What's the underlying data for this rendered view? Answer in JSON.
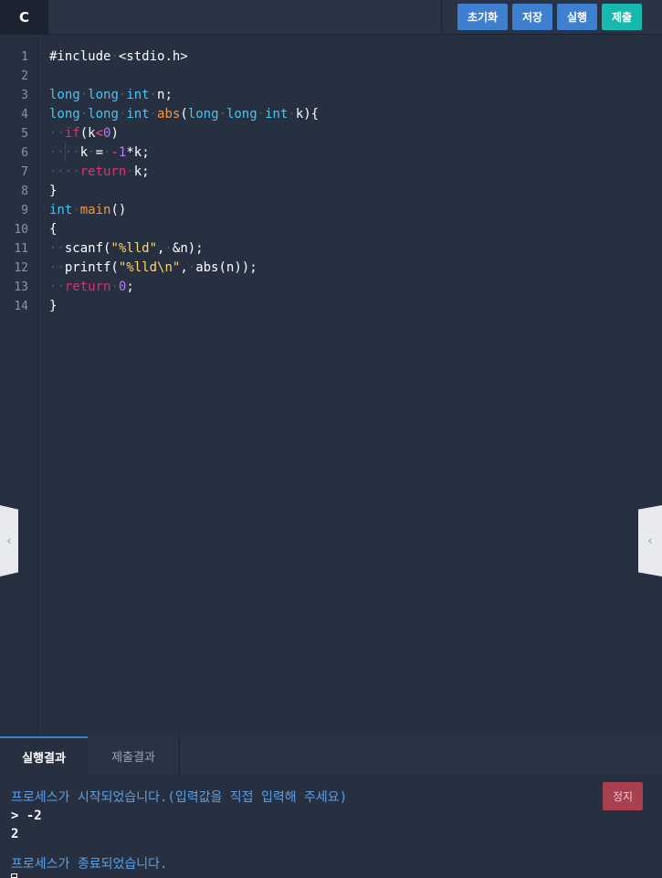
{
  "language_tab": "C",
  "toolbar": {
    "reset_label": "초기화",
    "save_label": "저장",
    "run_label": "실행",
    "submit_label": "제출"
  },
  "editor": {
    "line_numbers": [
      "1",
      "2",
      "3",
      "4",
      "5",
      "6",
      "7",
      "8",
      "9",
      "10",
      "11",
      "12",
      "13",
      "14"
    ]
  },
  "bottom_panel": {
    "tabs": [
      "실행결과",
      "제출결과"
    ],
    "active_tab": "실행결과",
    "stop_label": "정지",
    "console": {
      "start_message": "프로세스가 시작되었습니다.(입력값을 직접 입력해 주세요)",
      "input_line": "> -2",
      "output_line": "2",
      "end_message": "프로세스가 종료되었습니다."
    }
  },
  "colors": {
    "accent_blue": "#3f7fcf",
    "submit_teal": "#17b8ad",
    "stop_red": "#a8404f",
    "editor_bg": "#263040"
  },
  "icons": {
    "left_handle": "chevron-left-icon",
    "right_handle": "chevron-left-icon"
  }
}
